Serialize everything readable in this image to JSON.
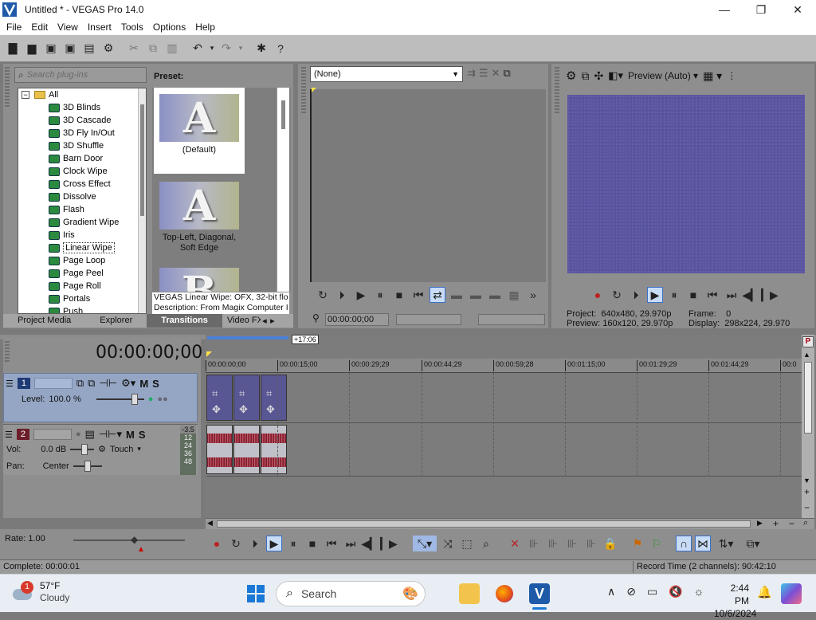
{
  "window": {
    "title": "Untitled * - VEGAS Pro 14.0",
    "minimize": "—",
    "maximize": "❐",
    "close": "✕"
  },
  "menu": [
    "File",
    "Edit",
    "View",
    "Insert",
    "Tools",
    "Options",
    "Help"
  ],
  "plugins": {
    "search_placeholder": "Search plug-ins",
    "root": "All",
    "items": [
      "3D Blinds",
      "3D Cascade",
      "3D Fly In/Out",
      "3D Shuffle",
      "Barn Door",
      "Clock Wipe",
      "Cross Effect",
      "Dissolve",
      "Flash",
      "Gradient Wipe",
      "Iris",
      "Linear Wipe",
      "Page Loop",
      "Page Peel",
      "Page Roll",
      "Portals",
      "Push"
    ],
    "selected": "Linear Wipe",
    "preset_label": "Preset:",
    "presets": [
      {
        "name": "(Default)",
        "glyph": "A"
      },
      {
        "name": "Top-Left, Diagonal, Soft Edge",
        "glyph": "A"
      },
      {
        "name": "",
        "glyph": "B"
      }
    ],
    "description_line1": "VEGAS Linear Wipe: OFX, 32-bit flo",
    "description_line2": "Description: From Magix Computer I",
    "tabs": [
      "Project Media",
      "Explorer",
      "Transitions",
      "Video FX"
    ],
    "active_tab": "Transitions"
  },
  "trimmer": {
    "selector_value": "(None)",
    "time": "00:00:00;00"
  },
  "preview": {
    "mode": "Preview (Auto)",
    "project_label": "Project:",
    "project_value": "640x480, 29.970p",
    "frame_label": "Frame:",
    "frame_value": "0",
    "preview_label": "Preview:",
    "preview_value": "160x120, 29.970p",
    "display_label": "Display:",
    "display_value": "298x224, 29.970"
  },
  "timeline": {
    "timecode": "00:00:00;00",
    "marker": "+17:06",
    "ruler": [
      "00:00:00;00",
      "00:00:15;00",
      "00:00:29;29",
      "00:00:44;29",
      "00:00:59;28",
      "00:01:15;00",
      "00:01:29;29",
      "00:01:44;29",
      "00:0"
    ],
    "video_track": {
      "number": "1",
      "level_label": "Level:",
      "level_value": "100.0 %",
      "mute": "M",
      "solo": "S"
    },
    "audio_track": {
      "number": "2",
      "vol_label": "Vol:",
      "vol_value": "0.0 dB",
      "pan_label": "Pan:",
      "pan_value": "Center",
      "mode": "Touch",
      "mute": "M",
      "solo": "S"
    },
    "meter": [
      "-3.5",
      "12",
      "24",
      "36",
      "48"
    ],
    "rate": "Rate: 1.00"
  },
  "status": {
    "left": "Complete: 00:00:01",
    "right": "Record Time (2 channels): 90:42:10"
  },
  "taskbar": {
    "temp": "57°F",
    "condition": "Cloudy",
    "badge": "1",
    "search": "Search",
    "time": "2:44 PM",
    "date": "10/6/2024"
  },
  "colors": {
    "accent_blue": "#3b6fc9",
    "track_video": "#95a6c4",
    "preview_fill": "#5a56a0"
  }
}
